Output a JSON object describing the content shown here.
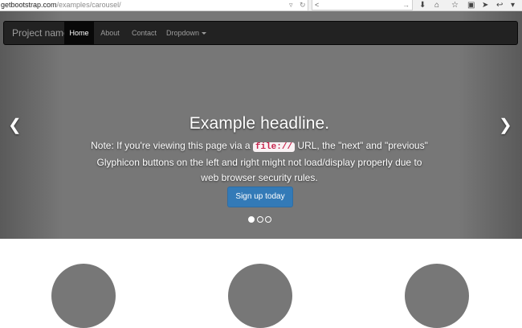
{
  "browser": {
    "url_host": "getbootstrap.com",
    "url_path": "/examples/carousel/",
    "search_value": "<",
    "icons": [
      "download-icon",
      "home-icon",
      "star-icon",
      "bookmark-icon",
      "send-icon",
      "back-icon",
      "menu-icon"
    ]
  },
  "navbar": {
    "brand": "Project name",
    "items": [
      {
        "label": "Home",
        "active": true
      },
      {
        "label": "About",
        "active": false
      },
      {
        "label": "Contact",
        "active": false
      },
      {
        "label": "Dropdown",
        "active": false
      }
    ]
  },
  "carousel": {
    "headline": "Example headline.",
    "note_before": "Note: If you're viewing this page via a ",
    "note_code": "file://",
    "note_after": " URL, the \"next\" and \"previous\" Glyphicon buttons on the left and right might not load/display properly due to web browser security rules.",
    "button_label": "Sign up today",
    "slides": 3,
    "active_slide": 1,
    "prev_glyph": "❮",
    "next_glyph": "❯"
  },
  "colors": {
    "navbar_bg": "#222222",
    "primary": "#337ab7",
    "hero_bg": "#777777"
  }
}
